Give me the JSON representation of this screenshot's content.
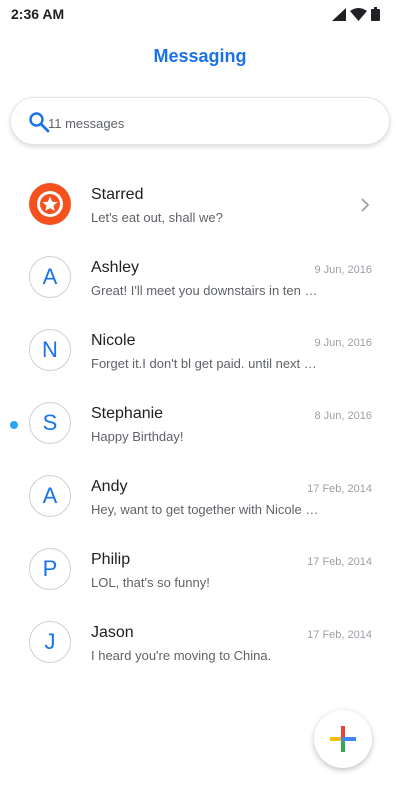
{
  "status_bar": {
    "time": "2:36 AM",
    "icons": [
      "signal-icon",
      "wifi-icon",
      "battery-icon"
    ]
  },
  "app": {
    "title": "Messaging"
  },
  "search": {
    "placeholder": "11 messages",
    "icon": "search-icon"
  },
  "conversations": [
    {
      "name": "Starred",
      "snippet": "Let's eat out, shall we?",
      "date": "",
      "avatar_letter": "",
      "avatar_icon": "star-icon",
      "unread": false,
      "has_chevron": true
    },
    {
      "name": "Ashley",
      "snippet": "Great! I'll meet you downstairs in ten …",
      "date": "9 Jun, 2016",
      "avatar_letter": "A",
      "unread": false
    },
    {
      "name": "Nicole",
      "snippet": "Forget it.I don't bl get paid. until next F…",
      "date": "9 Jun, 2016",
      "avatar_letter": "N",
      "unread": false
    },
    {
      "name": "Stephanie",
      "snippet": "Happy Birthday!",
      "date": "8 Jun, 2016",
      "avatar_letter": "S",
      "unread": true
    },
    {
      "name": "Andy",
      "snippet": "Hey, want to get together with Nicole …",
      "date": "17 Feb, 2014",
      "avatar_letter": "A",
      "unread": false
    },
    {
      "name": "Philip",
      "snippet": "LOL, that's so funny!",
      "date": "17 Feb, 2014",
      "avatar_letter": "P",
      "unread": false
    },
    {
      "name": "Jason",
      "snippet": "I heard you're moving to China.",
      "date": "17 Feb, 2014",
      "avatar_letter": "J",
      "unread": false
    }
  ],
  "fab": {
    "icon": "plus-icon"
  },
  "colors": {
    "accent": "#1a73e8",
    "starred_avatar": "#f4511e",
    "unread_dot": "#2aa4f4",
    "plus_red": "#ea4335",
    "plus_blue": "#4285f4",
    "plus_yellow": "#fbbc05",
    "plus_green": "#34a853"
  }
}
